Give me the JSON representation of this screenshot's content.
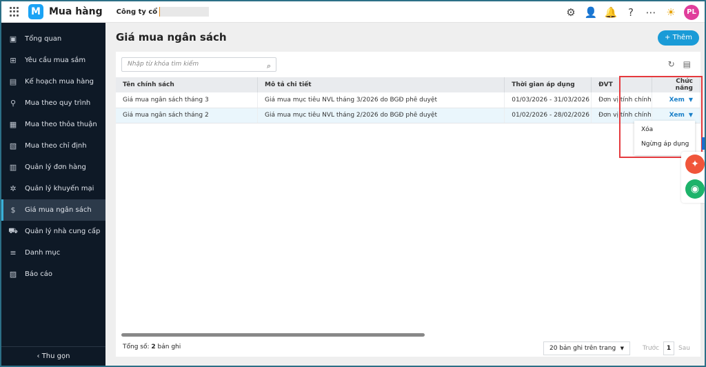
{
  "header": {
    "app_name": "Mua hàng",
    "company": "Công ty cổ",
    "avatar": "PL",
    "logo_letter": "M"
  },
  "sidebar": {
    "items": [
      {
        "label": "Tổng quan",
        "icon": "clipboard-icon"
      },
      {
        "label": "Yêu cầu mua sắm",
        "icon": "clipboard-plus-icon"
      },
      {
        "label": "Kế hoạch mua hàng",
        "icon": "plan-icon"
      },
      {
        "label": "Mua theo quy trình",
        "icon": "process-icon"
      },
      {
        "label": "Mua theo thỏa thuận",
        "icon": "agreement-icon"
      },
      {
        "label": "Mua theo chỉ định",
        "icon": "document-icon"
      },
      {
        "label": "Quản lý đơn hàng",
        "icon": "order-icon"
      },
      {
        "label": "Quản lý khuyến mại",
        "icon": "promotion-icon"
      },
      {
        "label": "Giá mua ngân sách",
        "icon": "budget-icon",
        "active": true
      },
      {
        "label": "Quản lý nhà cung cấp",
        "icon": "truck-icon"
      },
      {
        "label": "Danh mục",
        "icon": "list-icon"
      },
      {
        "label": "Báo cáo",
        "icon": "report-icon"
      }
    ],
    "collapse_label": "Thu gọn"
  },
  "page": {
    "title": "Giá mua ngân sách",
    "add_label": "+ Thêm"
  },
  "search": {
    "placeholder": "Nhập từ khóa tìm kiếm"
  },
  "table": {
    "columns": [
      "Tên chính sách",
      "Mô tả chi tiết",
      "Thời gian áp dụng",
      "ĐVT",
      "Chức năng"
    ],
    "rows": [
      {
        "name": "Giá mua ngân sách tháng 3",
        "desc": "Giá mua mục tiêu NVL tháng 3/2026 do BGĐ phê duyệt",
        "period": "01/03/2026 - 31/03/2026",
        "unit": "Đơn vị tính chính",
        "action": "Xem"
      },
      {
        "name": "Giá mua ngân sách tháng 2",
        "desc": "Giá mua mục tiêu NVL tháng 2/2026 do BGĐ phê duyệt",
        "period": "01/02/2026 - 28/02/2026",
        "unit": "Đơn vị tính chính",
        "action": "Xem"
      }
    ]
  },
  "menu": {
    "items": [
      "Xóa",
      "Ngừng áp dụng"
    ]
  },
  "footer": {
    "total_label": "Tổng số:",
    "total_count": "2",
    "total_suffix": "bản ghi",
    "page_size": "20 bản ghi trên trang",
    "prev": "Trước",
    "page": "1",
    "next": "Sau"
  },
  "colors": {
    "accent": "#1a9bd7",
    "sidebar": "#0e1926",
    "highlight": "#e5393d"
  }
}
